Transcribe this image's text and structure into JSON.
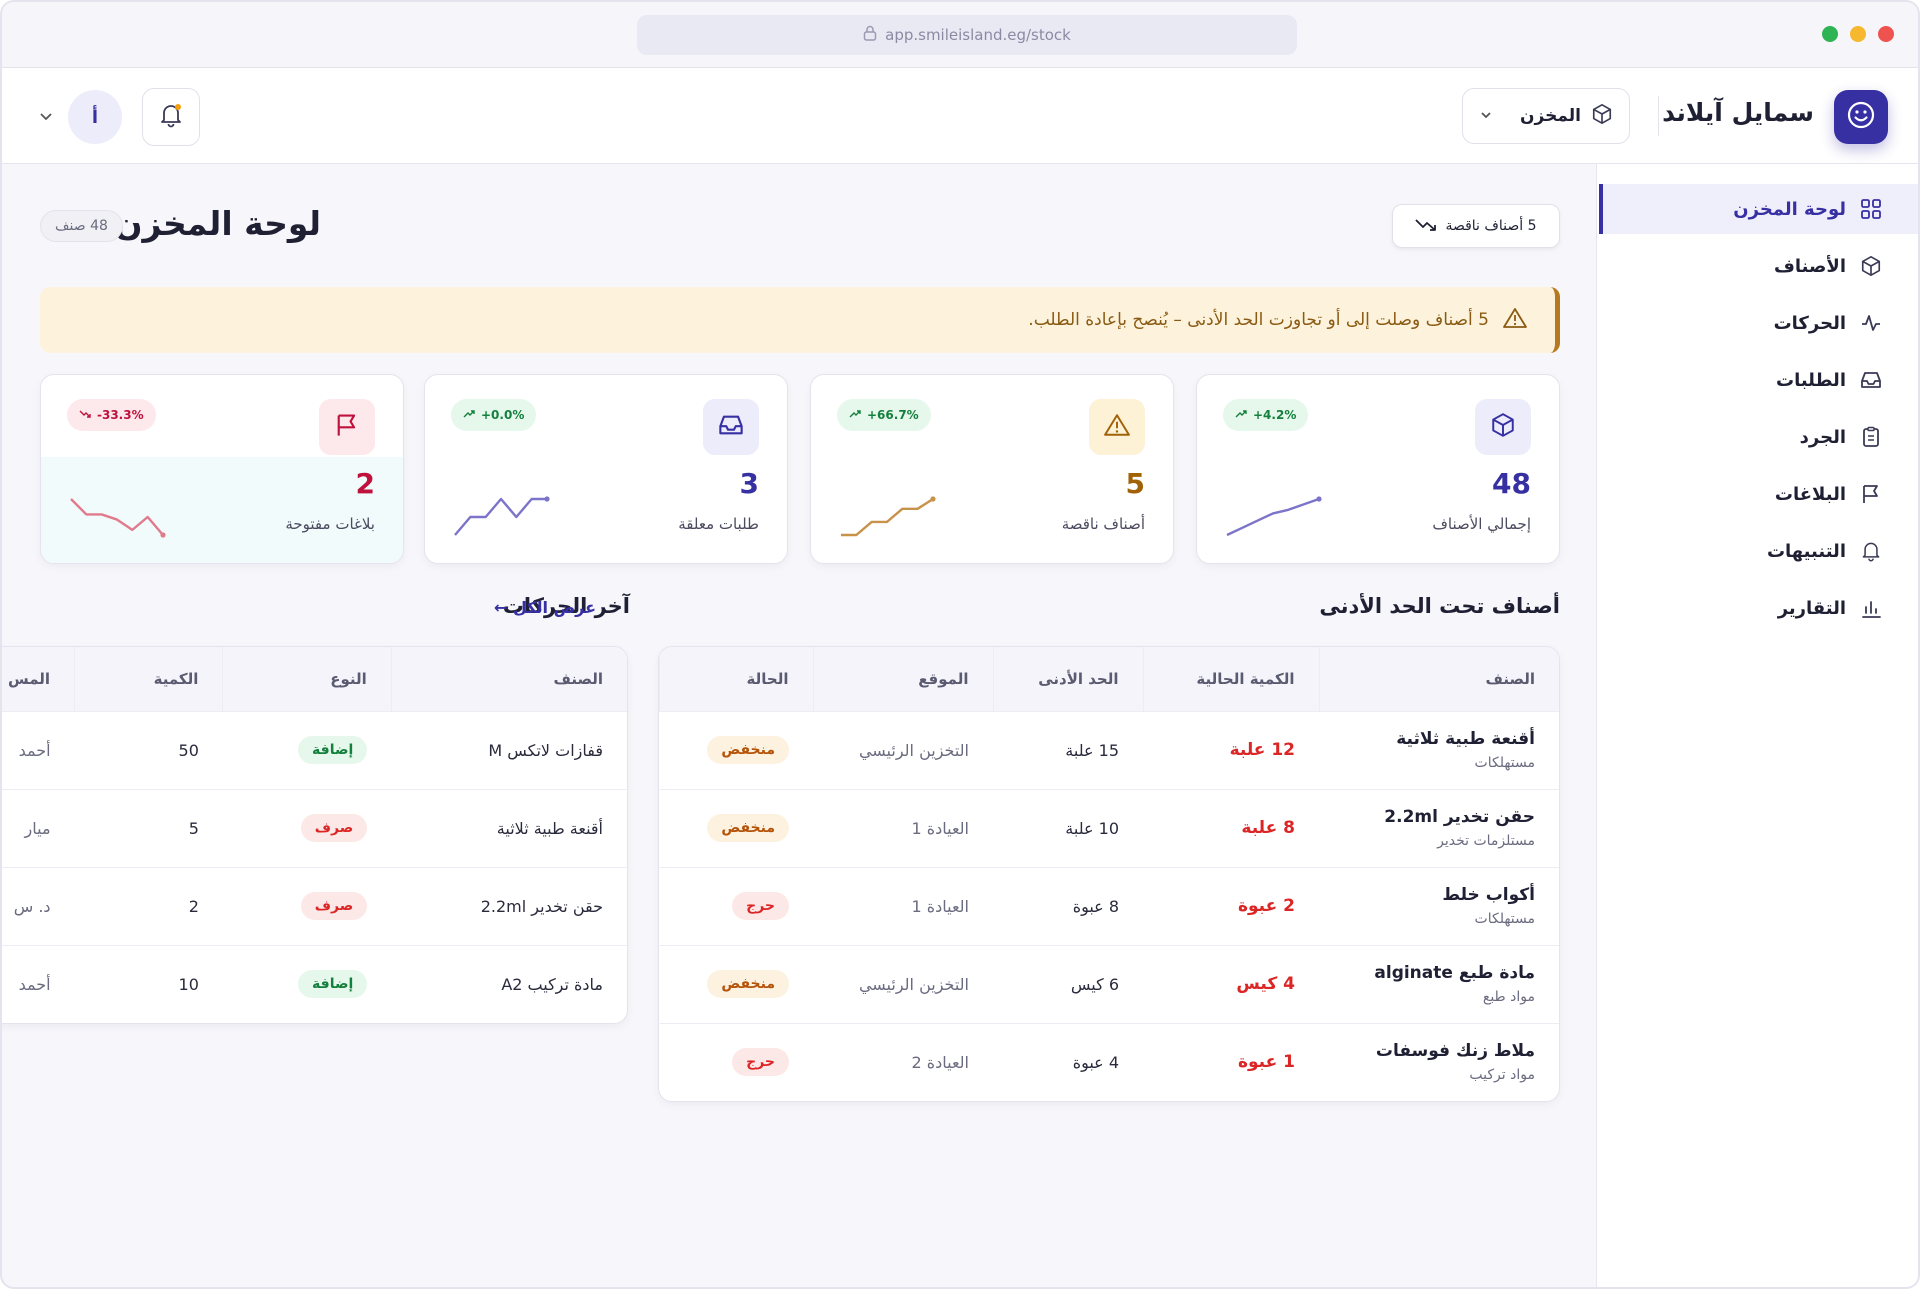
{
  "browser": {
    "url": "app.smileisland.eg/stock"
  },
  "header": {
    "brand_name": "سمايل آيلاند",
    "store_select": "المخزن",
    "avatar_initial": "أ"
  },
  "sidebar": {
    "items": [
      {
        "label": "لوحة المخزن",
        "icon": "grid-icon"
      },
      {
        "label": "الأصناف",
        "icon": "box-icon"
      },
      {
        "label": "الحركات",
        "icon": "activity-icon"
      },
      {
        "label": "الطلبات",
        "icon": "inbox-icon"
      },
      {
        "label": "الجرد",
        "icon": "clipboard-icon"
      },
      {
        "label": "البلاغات",
        "icon": "flag-icon"
      },
      {
        "label": "التنبيهات",
        "icon": "bell-icon"
      },
      {
        "label": "التقارير",
        "icon": "bar-chart-icon"
      }
    ]
  },
  "page": {
    "title": "لوحة المخزن",
    "count_pill": "48 صنف",
    "low_stock_chip": "5 أصناف ناقصة",
    "alert_text": "5 أصناف وصلت إلى أو تجاوزت الحد الأدنى – يُنصح بإعادة الطلب."
  },
  "stats": [
    {
      "value": "48",
      "label": "إجمالي الأصناف",
      "trend": "+4.2%",
      "icon": "box-icon",
      "accent": "#3730a3",
      "icon_bg": "#ececfb",
      "spark": [
        10,
        14,
        18,
        22,
        24,
        27,
        30
      ],
      "spark_color": "#7c74c9",
      "trend_dir": "up"
    },
    {
      "value": "5",
      "label": "أصناف ناقصة",
      "trend": "+66.7%",
      "icon": "warning-icon",
      "accent": "#a16207",
      "icon_bg": "#fdf1d6",
      "spark": [
        4,
        4,
        8,
        8,
        12,
        12,
        15
      ],
      "spark_color": "#c7924a",
      "trend_dir": "up"
    },
    {
      "value": "3",
      "label": "طلبات معلقة",
      "trend": "+0.0%",
      "icon": "inbox-icon",
      "accent": "#3730a3",
      "icon_bg": "#ececfb",
      "spark": [
        4,
        10,
        10,
        16,
        10,
        16,
        16
      ],
      "spark_color": "#7c74c9",
      "trend_dir": "up"
    },
    {
      "value": "2",
      "label": "بلاغات مفتوحة",
      "trend": "-33.3%",
      "icon": "flag-icon",
      "accent": "#be123c",
      "icon_bg": "#fde8ec",
      "spark": [
        16,
        10,
        10,
        8,
        4,
        9,
        2
      ],
      "spark_color": "#e07a8c",
      "trend_dir": "down"
    }
  ],
  "low_stock": {
    "title": "أصناف تحت الحد الأدنى",
    "columns": [
      "الصنف",
      "الكمية الحالية",
      "الحد الأدنى",
      "الموقع",
      "الحالة"
    ],
    "rows": [
      {
        "name": "أقنعة طبية ثلاثية",
        "category": "مستهلكات",
        "qty": "12 علبة",
        "min": "15 علبة",
        "location": "التخزين الرئيسي",
        "status": "منخفض",
        "status_kind": "low"
      },
      {
        "name": "حقن تخدير 2.2ml",
        "category": "مستلزمات تخدير",
        "qty": "8 علبة",
        "min": "10 علبة",
        "location": "العيادة 1",
        "status": "منخفض",
        "status_kind": "low"
      },
      {
        "name": "أكواب خلط",
        "category": "مستهلكات",
        "qty": "2 عبوة",
        "min": "8 عبوة",
        "location": "العيادة 1",
        "status": "حرج",
        "status_kind": "crit"
      },
      {
        "name": "مادة طبع alginate",
        "category": "مواد طبع",
        "qty": "4 كيس",
        "min": "6 كيس",
        "location": "التخزين الرئيسي",
        "status": "منخفض",
        "status_kind": "low"
      },
      {
        "name": "ملاط زنك فوسفات",
        "category": "مواد تركيب",
        "qty": "1 عبوة",
        "min": "4 عبوة",
        "location": "العيادة 2",
        "status": "حرج",
        "status_kind": "crit"
      }
    ]
  },
  "movements": {
    "title": "آخر الحركات",
    "view_all": "عرض الكل ←",
    "columns": [
      "الصنف",
      "النوع",
      "الكمية",
      "المس"
    ],
    "rows": [
      {
        "item": "قفازات لاتكس M",
        "type": "إضافة",
        "type_kind": "add",
        "qty": "50",
        "by": "أحمد"
      },
      {
        "item": "أقنعة طبية ثلاثية",
        "type": "صرف",
        "type_kind": "out",
        "qty": "5",
        "by": "ميار"
      },
      {
        "item": "حقن تخدير 2.2ml",
        "type": "صرف",
        "type_kind": "out",
        "qty": "2",
        "by": "د. س"
      },
      {
        "item": "مادة تركيب A2",
        "type": "إضافة",
        "type_kind": "add",
        "qty": "10",
        "by": "أحمد"
      }
    ]
  }
}
